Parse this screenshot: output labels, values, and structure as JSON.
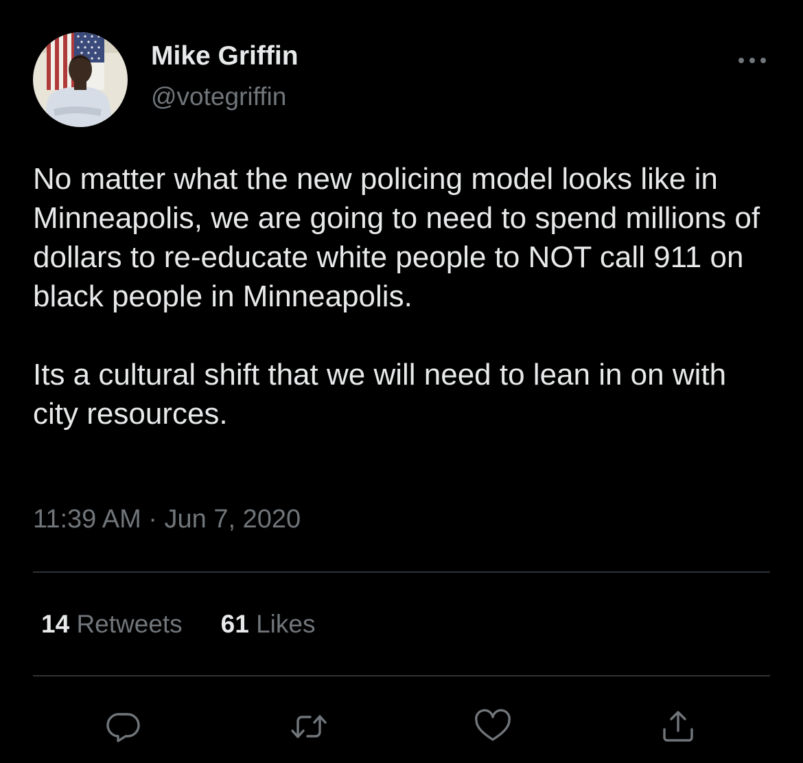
{
  "author": {
    "display_name": "Mike Griffin",
    "handle": "@votegriffin",
    "avatar_icon": "profile-photo"
  },
  "tweet": {
    "paragraphs": [
      "No matter what the new policing model looks like in Minneapolis, we are going to need to spend millions of dollars to re-educate white people to NOT call 911 on black people in Minneapolis.",
      "Its a cultural shift that we will need to lean in on with city resources."
    ],
    "timestamp": "11:39 AM · Jun 7, 2020"
  },
  "stats": {
    "retweets_count": "14",
    "retweets_label": "Retweets",
    "likes_count": "61",
    "likes_label": "Likes"
  },
  "actions": {
    "icons": [
      "reply-icon",
      "retweet-icon",
      "like-icon",
      "share-icon"
    ]
  },
  "colors": {
    "background": "#000000",
    "primary_text": "#e7e9ea",
    "secondary_text": "#71767b",
    "divider": "#2f3336"
  }
}
